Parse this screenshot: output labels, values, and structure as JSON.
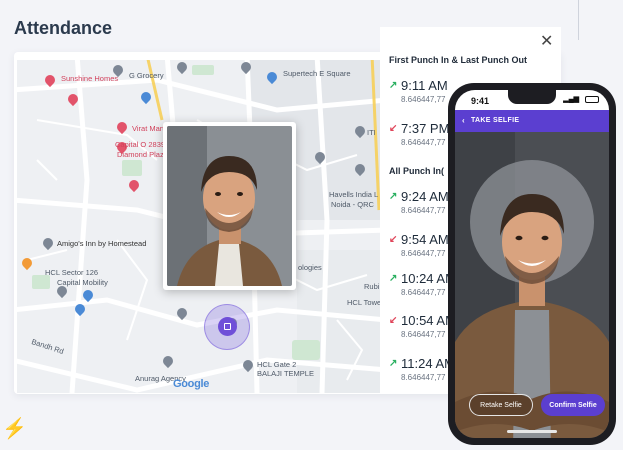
{
  "page": {
    "title": "Attendance"
  },
  "map": {
    "places": [
      {
        "name": "Sunshine Homes",
        "tone": "red"
      },
      {
        "name": "G Grocery",
        "tone": "gray"
      },
      {
        "name": "Supertech E Square",
        "tone": "gray"
      },
      {
        "name": "Virat Mart",
        "tone": "red"
      },
      {
        "name": "Capital O 28393",
        "tone": "red"
      },
      {
        "name": "Diamond Plaza",
        "tone": "red"
      },
      {
        "name": "Havells India L",
        "tone": "gray"
      },
      {
        "name": "Noida - QRC",
        "tone": "gray"
      },
      {
        "name": "Amigo's Inn by Homestead",
        "tone": "dark"
      },
      {
        "name": "HCL Sector 126",
        "tone": "gray"
      },
      {
        "name": "Capital Mobility",
        "tone": "gray"
      },
      {
        "name": "HCL Tower 3",
        "tone": "gray"
      },
      {
        "name": "HCL Gate 2",
        "tone": "gray"
      },
      {
        "name": "BALAJI TEMPLE",
        "tone": "gray"
      },
      {
        "name": "Anurag Agency",
        "tone": "gray"
      },
      {
        "name": "Bandh Rd",
        "tone": "gray"
      },
      {
        "name": "Rubi",
        "tone": "gray"
      },
      {
        "name": "ITI",
        "tone": "gray"
      },
      {
        "name": "ologies",
        "tone": "gray"
      }
    ],
    "attribution": "Google"
  },
  "panel": {
    "close_icon": "close-icon",
    "first_last_title": "First Punch In & Last Punch Out",
    "first_last": [
      {
        "direction": "in",
        "time": "9:11 AM",
        "coords": "8.646447,77"
      },
      {
        "direction": "out",
        "time": "7:37 PM",
        "coords": "8.646447,77"
      }
    ],
    "all_title": "All Punch In(",
    "all": [
      {
        "direction": "in",
        "time": "9:24 AM",
        "coords": "8.646447,77"
      },
      {
        "direction": "out",
        "time": "9:54 AM",
        "coords": "8.646447,77"
      },
      {
        "direction": "in",
        "time": "10:24 AM",
        "coords": "8.646447,77"
      },
      {
        "direction": "out",
        "time": "10:54 AM",
        "coords": "8.646447,77"
      },
      {
        "direction": "in",
        "time": "11:24 AM",
        "coords": "8.646447,77"
      }
    ]
  },
  "phone": {
    "status_time": "9:41",
    "app_title": "TAKE SELFIE",
    "retake_label": "Retake Selfie",
    "confirm_label": "Confirm Selfie"
  },
  "colors": {
    "accent": "#5b3fd0",
    "punch_in": "#2bb061",
    "punch_out": "#e0455a",
    "poi_red": "#d2425c",
    "map_bg": "#eef0f3"
  }
}
